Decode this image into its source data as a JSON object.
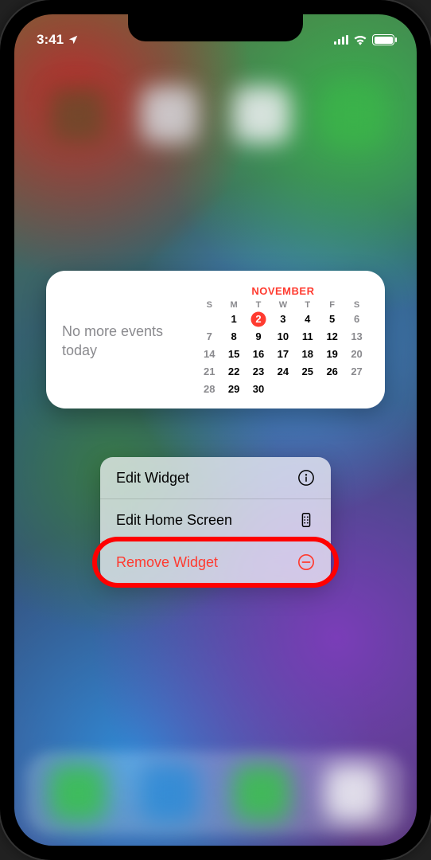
{
  "status": {
    "time": "3:41",
    "location_active": true,
    "signal_bars": 4,
    "wifi": true,
    "battery_pct": 100
  },
  "widget": {
    "no_events_text": "No more events today",
    "calendar": {
      "month_label": "NOVEMBER",
      "day_headers": [
        "S",
        "M",
        "T",
        "W",
        "T",
        "F",
        "S"
      ],
      "weeks": [
        [
          null,
          1,
          2,
          3,
          4,
          5,
          6
        ],
        [
          7,
          8,
          9,
          10,
          11,
          12,
          13
        ],
        [
          14,
          15,
          16,
          17,
          18,
          19,
          20
        ],
        [
          21,
          22,
          23,
          24,
          25,
          26,
          27
        ],
        [
          28,
          29,
          30,
          null,
          null,
          null,
          null
        ]
      ],
      "today": 2
    }
  },
  "menu": {
    "items": [
      {
        "label": "Edit Widget",
        "icon": "info-circle-icon",
        "destructive": false
      },
      {
        "label": "Edit Home Screen",
        "icon": "apps-rect-icon",
        "destructive": false
      },
      {
        "label": "Remove Widget",
        "icon": "minus-circle-icon",
        "destructive": true
      }
    ]
  },
  "annotation": {
    "highlighted_menu_index": 2
  }
}
